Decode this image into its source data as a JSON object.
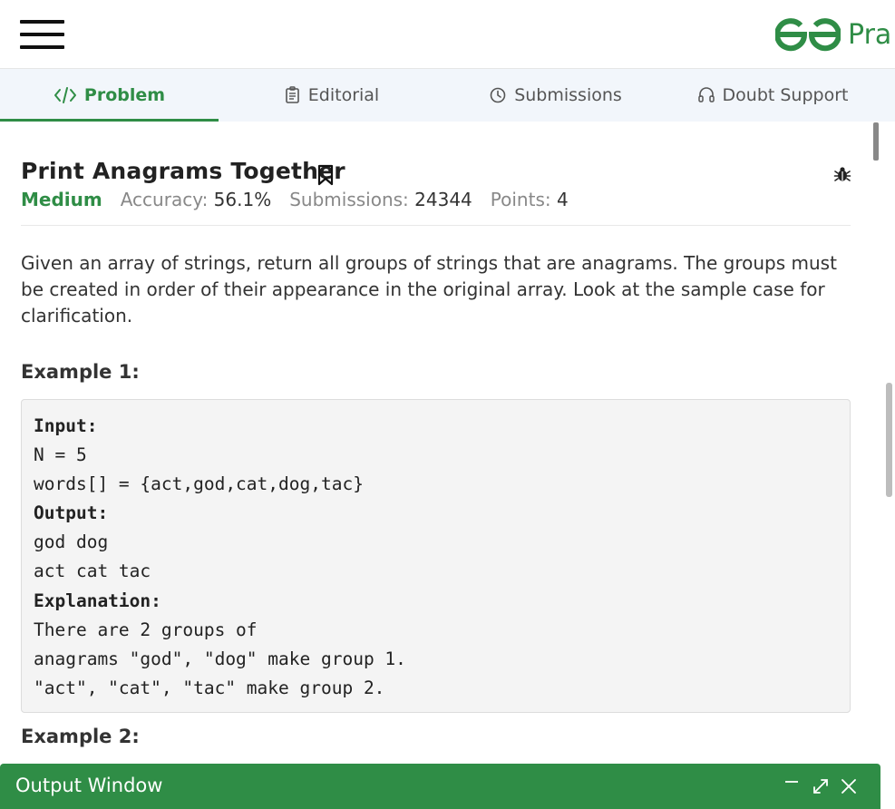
{
  "header": {
    "logo_text": "Pra"
  },
  "tabs": [
    {
      "label": "Problem",
      "icon": "code-icon",
      "active": true
    },
    {
      "label": "Editorial",
      "icon": "document-icon",
      "active": false
    },
    {
      "label": "Submissions",
      "icon": "clock-icon",
      "active": false
    },
    {
      "label": "Doubt Support",
      "icon": "headset-icon",
      "active": false
    }
  ],
  "problem": {
    "title": "Print Anagrams Together",
    "difficulty": "Medium",
    "accuracy_label": "Accuracy:",
    "accuracy_value": "56.1%",
    "submissions_label": "Submissions:",
    "submissions_value": "24344",
    "points_label": "Points:",
    "points_value": "4",
    "description": "Given an array of strings, return all groups of strings that are anagrams. The groups must be created in order of their appearance in the original array. Look at the sample case for clarification."
  },
  "example1": {
    "heading": "Example 1:",
    "lines": [
      {
        "text": "Input:",
        "bold": true
      },
      {
        "text": "N = 5",
        "bold": false
      },
      {
        "text": "words[] = {act,god,cat,dog,tac}",
        "bold": false
      },
      {
        "text": "Output:",
        "bold": true
      },
      {
        "text": "god dog",
        "bold": false
      },
      {
        "text": "act cat tac",
        "bold": false
      },
      {
        "text": "Explanation:",
        "bold": true
      },
      {
        "text": "There are 2 groups of",
        "bold": false
      },
      {
        "text": "anagrams \"god\", \"dog\" make group 1.",
        "bold": false
      },
      {
        "text": "\"act\", \"cat\", \"tac\" make group 2.",
        "bold": false
      }
    ]
  },
  "example2": {
    "heading": "Example 2:"
  },
  "output_window": {
    "title": "Output Window"
  },
  "colors": {
    "brand_green": "#2f8d46",
    "tab_bar_bg": "#f2f6fb"
  }
}
